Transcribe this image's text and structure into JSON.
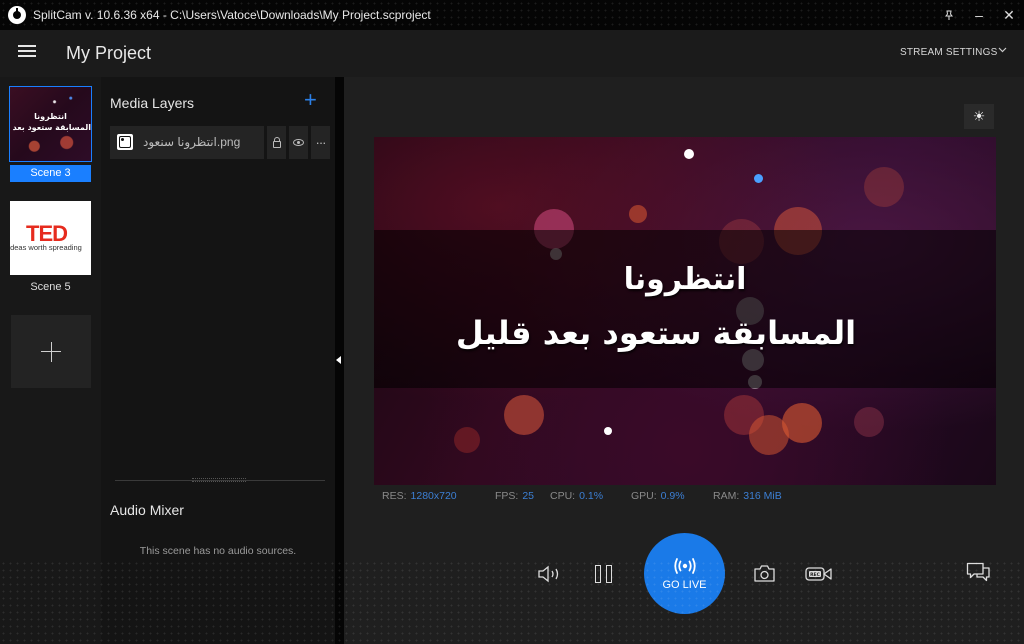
{
  "window": {
    "title": "SplitCam v. 10.6.36 x64 - C:\\Users\\Vatoce\\Downloads\\My Project.scproject",
    "controls": {
      "pin": "pin-icon",
      "minimize": "–",
      "close": "✕"
    }
  },
  "header": {
    "menu_icon": "hamburger-menu-icon",
    "project_title": "My Project",
    "stream_settings_label": "STREAM SETTINGS",
    "chevron": "⌄"
  },
  "scenes": {
    "items": [
      {
        "label": "Scene 3",
        "active": true,
        "thumb_text_line1": "انتظرونا",
        "thumb_text_line2": "المسابقة ستعود بعد قليل"
      },
      {
        "label": "Scene 5",
        "active": false,
        "thumb_logo": "TED",
        "thumb_tagline": "Ideas worth spreading"
      }
    ],
    "add_icon": "plus-icon"
  },
  "layers": {
    "title": "Media Layers",
    "add_icon": "+",
    "items": [
      {
        "name": "انتظرونا سنعود.png",
        "icon": "image-icon",
        "locked": false,
        "visible": true
      }
    ],
    "more_label": "···"
  },
  "audio": {
    "title": "Audio Mixer",
    "empty_message": "This scene has no audio sources."
  },
  "preview": {
    "line1": "انتظرونا",
    "line2": "المسابقة ستعود بعد قليل",
    "brightness_icon": "☀"
  },
  "stats": {
    "res_label": "RES:",
    "res_value": "1280x720",
    "fps_label": "FPS:",
    "fps_value": "25",
    "cpu_label": "CPU:",
    "cpu_value": "0.1%",
    "gpu_label": "GPU:",
    "gpu_value": "0.9%",
    "ram_label": "RAM:",
    "ram_value": "316 MiB"
  },
  "controls": {
    "go_live_icon": "((•))",
    "go_live_label": "GO LIVE",
    "rec_label": "REC",
    "accent": "#1a7ae8"
  }
}
